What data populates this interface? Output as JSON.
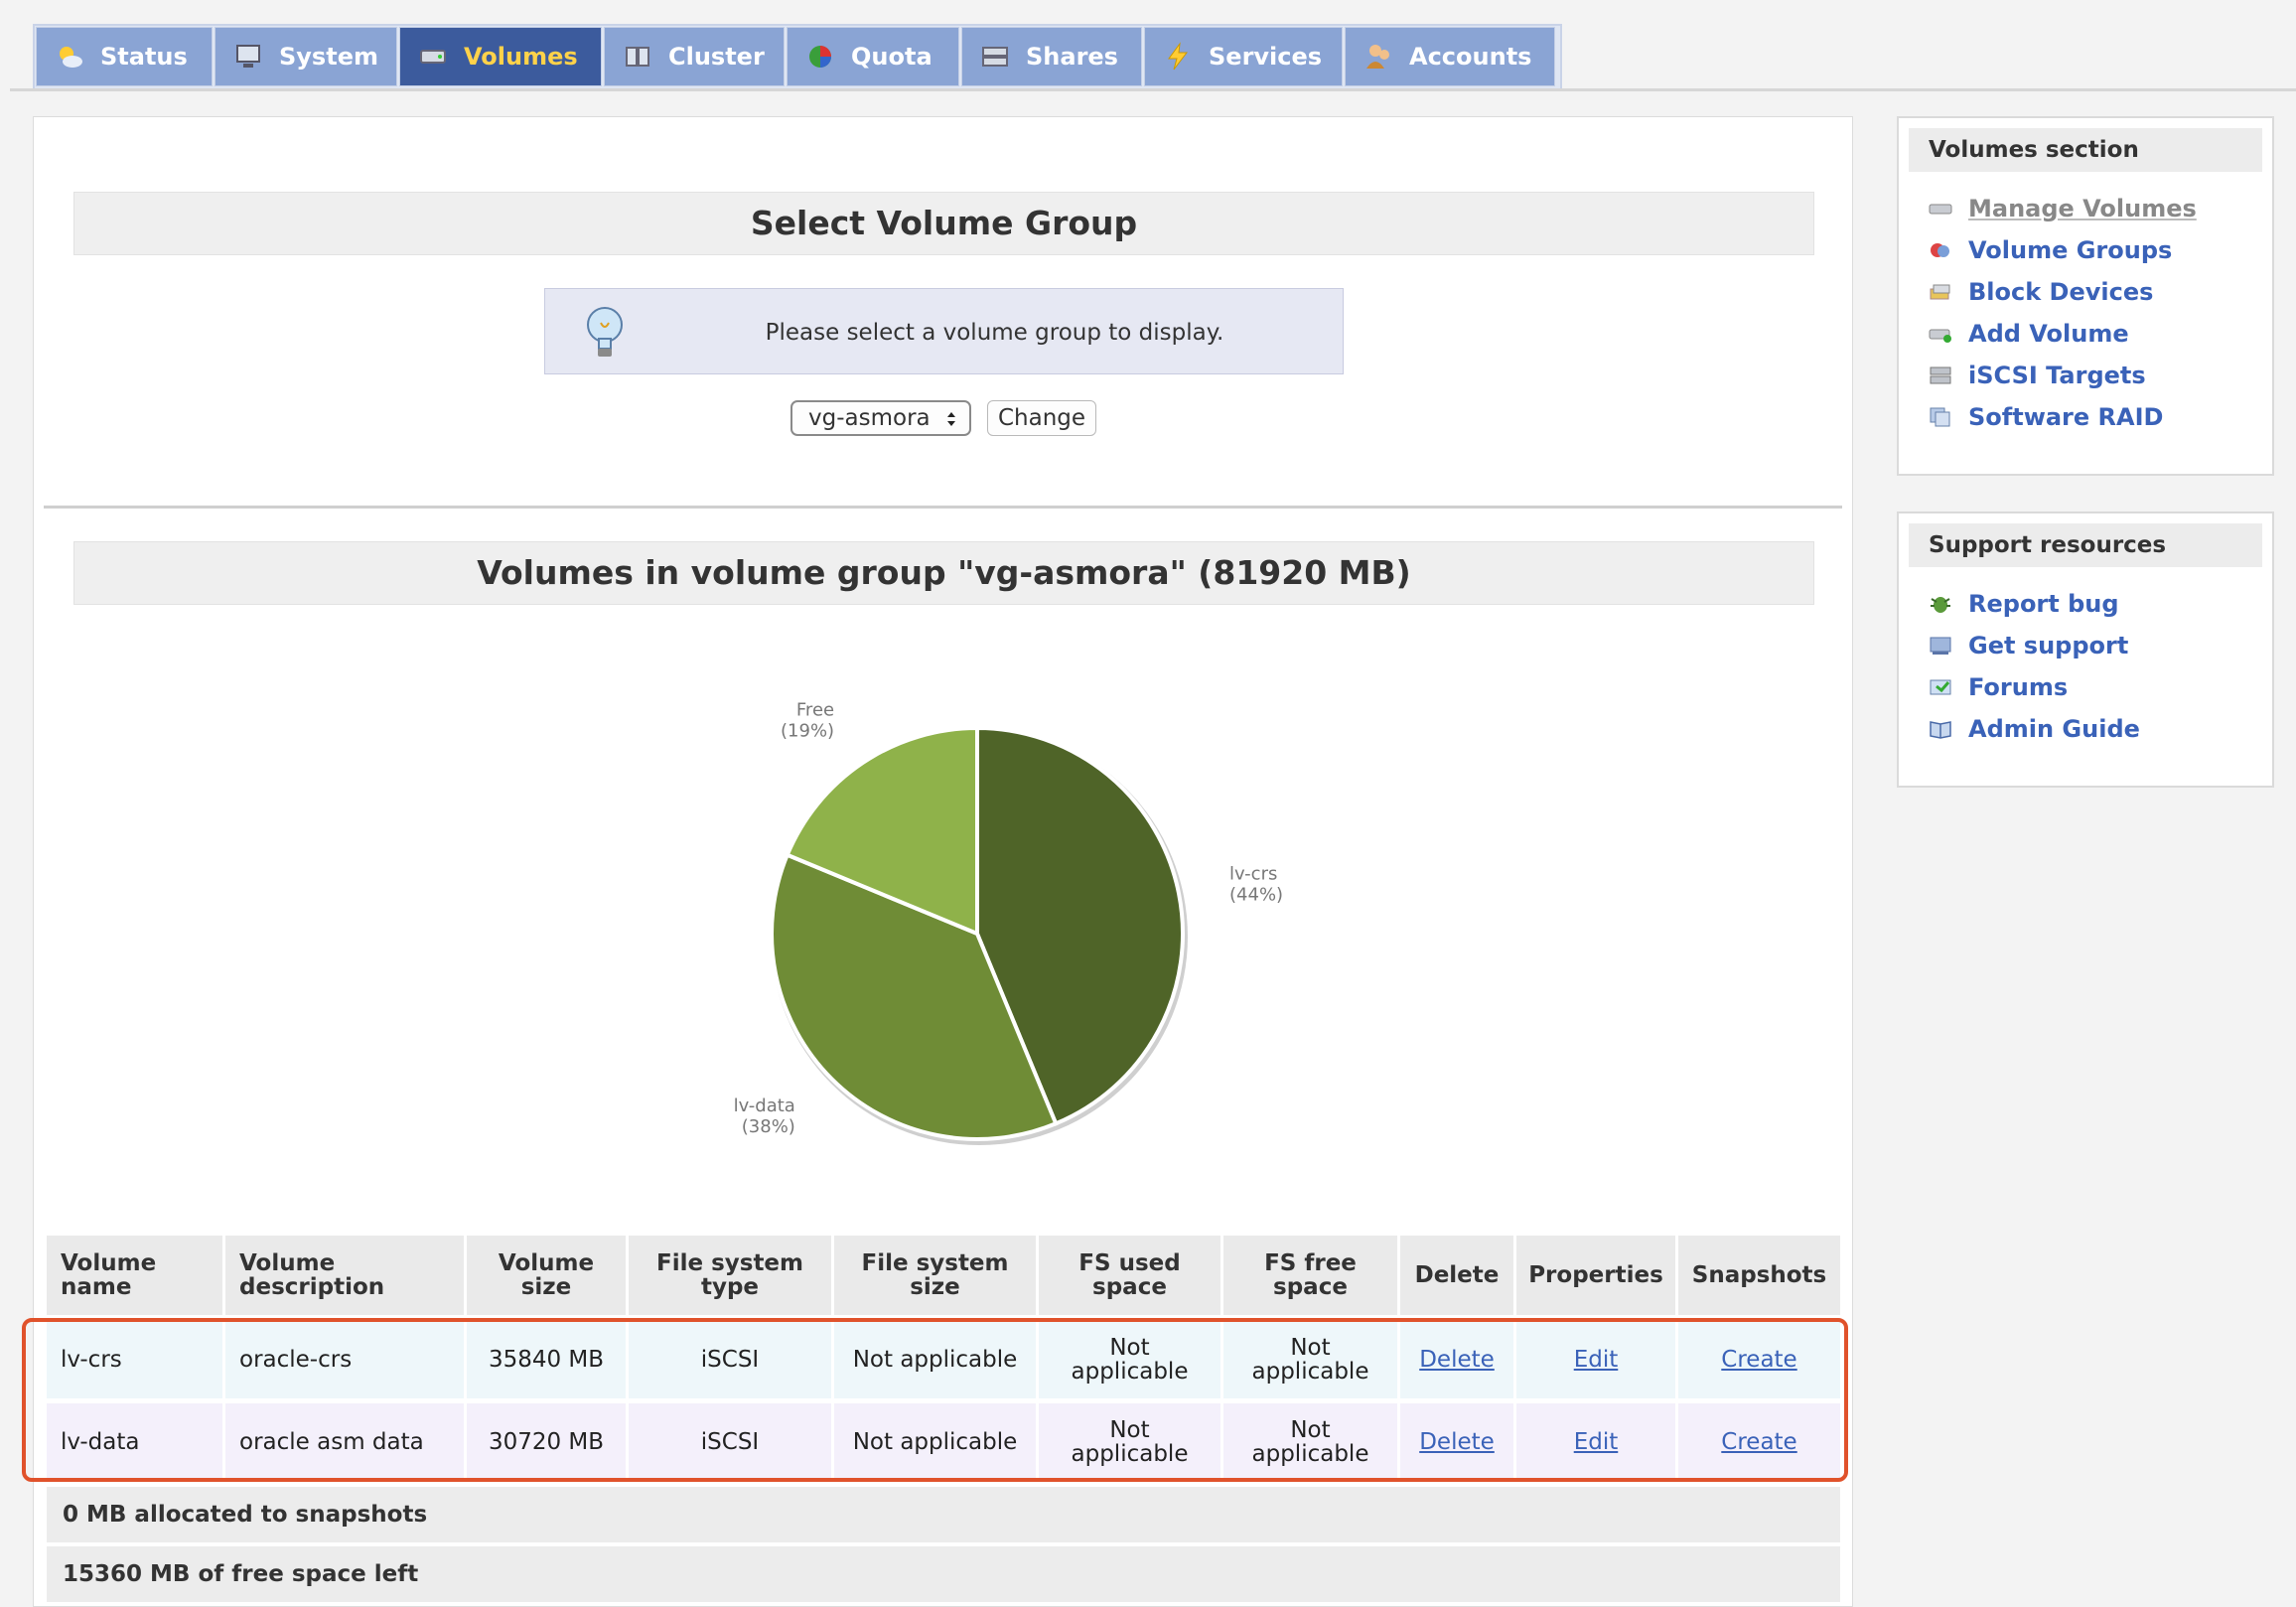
{
  "tabs": [
    {
      "label": "Status",
      "icon": "status-icon",
      "active": false
    },
    {
      "label": "System",
      "icon": "system-icon",
      "active": false
    },
    {
      "label": "Volumes",
      "icon": "volumes-icon",
      "active": true
    },
    {
      "label": "Cluster",
      "icon": "cluster-icon",
      "active": false
    },
    {
      "label": "Quota",
      "icon": "quota-icon",
      "active": false
    },
    {
      "label": "Shares",
      "icon": "shares-icon",
      "active": false
    },
    {
      "label": "Services",
      "icon": "services-icon",
      "active": false
    },
    {
      "label": "Accounts",
      "icon": "accounts-icon",
      "active": false
    }
  ],
  "select_section": {
    "title": "Select Volume Group",
    "info_text": "Please select a volume group to display.",
    "info_icon": "lightbulb-icon",
    "selected_group": "vg-asmora",
    "change_label": "Change"
  },
  "volumes_section": {
    "title": "Volumes in volume group \"vg-asmora\" (81920 MB)"
  },
  "chart_data": {
    "type": "pie",
    "slices": [
      {
        "label": "lv-crs",
        "percent_label": "(44%)",
        "value": 35840,
        "color": "#4f6428"
      },
      {
        "label": "lv-data",
        "percent_label": "(38%)",
        "value": 30720,
        "color": "#6f8c36"
      },
      {
        "label": "Free",
        "percent_label": "(19%)",
        "value": 15360,
        "color": "#8fb24a"
      }
    ]
  },
  "table": {
    "headers": {
      "name": [
        "Volume",
        "name"
      ],
      "description": [
        "Volume",
        "description"
      ],
      "size": [
        "Volume",
        "size"
      ],
      "fstype": [
        "File system",
        "type"
      ],
      "fssize": [
        "File system",
        "size"
      ],
      "used": [
        "FS used",
        "space"
      ],
      "free": [
        "FS free",
        "space"
      ],
      "delete": "Delete",
      "properties": "Properties",
      "snapshots": "Snapshots"
    },
    "rows": [
      {
        "name": "lv-crs",
        "description": "oracle-crs",
        "size": "35840 MB",
        "fstype": "iSCSI",
        "fssize": "Not applicable",
        "used": [
          "Not",
          "applicable"
        ],
        "free": [
          "Not",
          "applicable"
        ],
        "delete": "Delete",
        "properties": "Edit",
        "snapshots": "Create"
      },
      {
        "name": "lv-data",
        "description": "oracle asm data",
        "size": "30720 MB",
        "fstype": "iSCSI",
        "fssize": "Not applicable",
        "used": [
          "Not",
          "applicable"
        ],
        "free": [
          "Not",
          "applicable"
        ],
        "delete": "Delete",
        "properties": "Edit",
        "snapshots": "Create"
      }
    ],
    "summary_snapshots": "0 MB allocated to snapshots",
    "summary_free": "15360 MB of free space left"
  },
  "sidebar": {
    "volumes": {
      "title": "Volumes section",
      "items": [
        {
          "label": "Manage Volumes",
          "icon": "drive-icon",
          "current": true
        },
        {
          "label": "Volume Groups",
          "icon": "volume-groups-icon",
          "current": false
        },
        {
          "label": "Block Devices",
          "icon": "block-devices-icon",
          "current": false
        },
        {
          "label": "Add Volume",
          "icon": "add-volume-icon",
          "current": false
        },
        {
          "label": "iSCSI Targets",
          "icon": "iscsi-targets-icon",
          "current": false
        },
        {
          "label": "Software RAID",
          "icon": "software-raid-icon",
          "current": false
        }
      ]
    },
    "support": {
      "title": "Support resources",
      "items": [
        {
          "label": "Report bug",
          "icon": "bug-icon"
        },
        {
          "label": "Get support",
          "icon": "support-icon"
        },
        {
          "label": "Forums",
          "icon": "forums-icon"
        },
        {
          "label": "Admin Guide",
          "icon": "book-icon"
        }
      ]
    }
  },
  "colors": {
    "tab_bg": "#8aa4d4",
    "tab_active_bg": "#3c5b9d",
    "tab_active_text": "#ffd24a",
    "link": "#3a62b8",
    "highlight": "#e0522b"
  }
}
